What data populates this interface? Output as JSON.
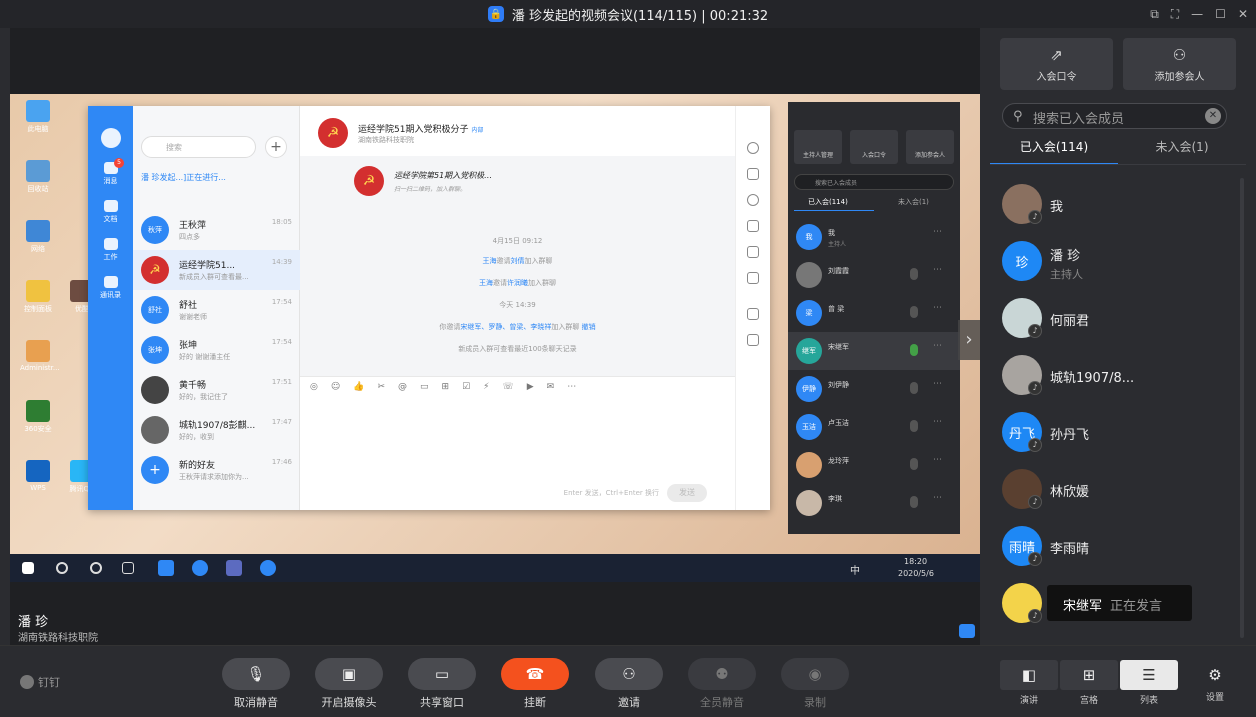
{
  "window": {
    "title": "潘 珍发起的视频会议(114/115) | 00:21:32"
  },
  "speaker": {
    "name": "潘 珍",
    "org": "湖南铁路科技职院"
  },
  "sidebar": {
    "btn_code": "入会口令",
    "btn_add": "添加参会人",
    "search_placeholder": "搜索已入会成员",
    "tab_joined": "已入会(114)",
    "tab_not_joined": "未入会(1)",
    "members": [
      {
        "name": "我",
        "avatar": "",
        "color": "#8a7060"
      },
      {
        "name": "潘  珍",
        "sub": "主持人",
        "avatar": "珍",
        "color": "#1e88f5"
      },
      {
        "name": "何丽君",
        "avatar": "",
        "color": "#c9d6d6"
      },
      {
        "name": "城轨1907/8...",
        "avatar": "",
        "color": "#a8a4a0"
      },
      {
        "name": "孙丹飞",
        "avatar": "丹飞",
        "color": "#1e88f5"
      },
      {
        "name": "林欣媛",
        "avatar": "",
        "color": "#5a4030"
      },
      {
        "name": "李雨晴",
        "avatar": "雨晴",
        "color": "#1e88f5"
      },
      {
        "name": "宋继军",
        "avatar": "",
        "color": "#f3d34a",
        "status": "正在发言"
      }
    ]
  },
  "controls": {
    "brand": "钉钉",
    "unmute": "取消静音",
    "camera": "开启摄像头",
    "share": "共享窗口",
    "hangup": "挂断",
    "invite": "邀请",
    "mute_all": "全员静音",
    "record": "录制",
    "view_speaker": "演讲",
    "view_grid": "宫格",
    "view_list": "列表",
    "settings": "设置"
  },
  "shared_screen": {
    "dingtalk": {
      "search": "搜索",
      "meeting_banner": "潘  珍发起...]正在进行...",
      "unread": "5",
      "nav": [
        "消息",
        "文档",
        "工作",
        "通讯录"
      ],
      "chats": [
        {
          "name": "王秋萍",
          "avatar": "秋萍",
          "preview": "四点多",
          "time": "18:05",
          "color": "#2f88f5"
        },
        {
          "name": "运经学院51...",
          "avatar": "☭",
          "preview": "新成员入群可查看最...",
          "time": "14:39",
          "color": "#d32f2f",
          "tag": "内部"
        },
        {
          "name": "舒社",
          "avatar": "舒社",
          "preview": "谢谢老师",
          "time": "17:54",
          "color": "#2f88f5"
        },
        {
          "name": "张坤",
          "avatar": "张坤",
          "preview": "好的  谢谢潘主任",
          "time": "17:54",
          "color": "#2f88f5"
        },
        {
          "name": "黄千畅",
          "avatar": "",
          "preview": "好的，我记住了",
          "time": "17:51",
          "color": "#444"
        },
        {
          "name": "城轨1907/8彭麒...",
          "avatar": "",
          "preview": "好的，收到",
          "time": "17:47",
          "color": "#666"
        },
        {
          "name": "新的好友",
          "avatar": "+",
          "preview": "王秋萍请求添加你为...",
          "time": "17:46",
          "color": "#2f88f5"
        }
      ],
      "group_title": "运经学院51期入党积极分子",
      "group_tag": "内部",
      "group_sub": "湖南铁路科技职院",
      "card_title": "运经学院第51期入党积极…",
      "card_sub": "扫一扫二维码，加入群聊。",
      "sys_date": "4月15日 09:12",
      "sys1_name": "王海",
      "sys1_mid": "邀请",
      "sys1_target": "刘倩",
      "sys1_end": "加入群聊",
      "sys2_name": "王海",
      "sys2_mid": "邀请",
      "sys2_target": "许润曦",
      "sys2_end": "加入群聊",
      "sys_today": "今天 14:39",
      "sys3_pre": "你邀请",
      "sys3_names": "宋继军、罗静、曾梁、李晓祥",
      "sys3_end": "加入群聊",
      "sys3_undo": "撤销",
      "sys4": "新成员入群可查看最近100条聊天记录",
      "send_hint": "Enter 发送，Ctrl+Enter 换行",
      "send": "发送"
    },
    "mini_panel": {
      "btn1": "主持人管理",
      "btn2": "入会口令",
      "btn3": "添加参会人",
      "search": "搜索已入会成员",
      "tab1": "已入会(114)",
      "tab2": "未入会(1)",
      "rows": [
        {
          "name": "我",
          "sub": "主持人",
          "avatar": "我"
        },
        {
          "name": "刘霞霞",
          "avatar": ""
        },
        {
          "name": "曾  梁",
          "avatar": "梁"
        },
        {
          "name": "宋继军",
          "avatar": "继军"
        },
        {
          "name": "刘伊静",
          "avatar": "伊静"
        },
        {
          "name": "卢玉洁",
          "avatar": "玉洁"
        },
        {
          "name": "龙玲萍",
          "avatar": ""
        },
        {
          "name": "李琪",
          "avatar": ""
        }
      ]
    },
    "taskbar": {
      "ime": "中",
      "time": "18:20",
      "date": "2020/5/6"
    },
    "desktop_labels": [
      "此电脑",
      "回收站",
      "网络",
      "控制面板",
      "Administr...",
      "360安全",
      "WPS",
      "优酷",
      "腾讯QQ"
    ]
  }
}
